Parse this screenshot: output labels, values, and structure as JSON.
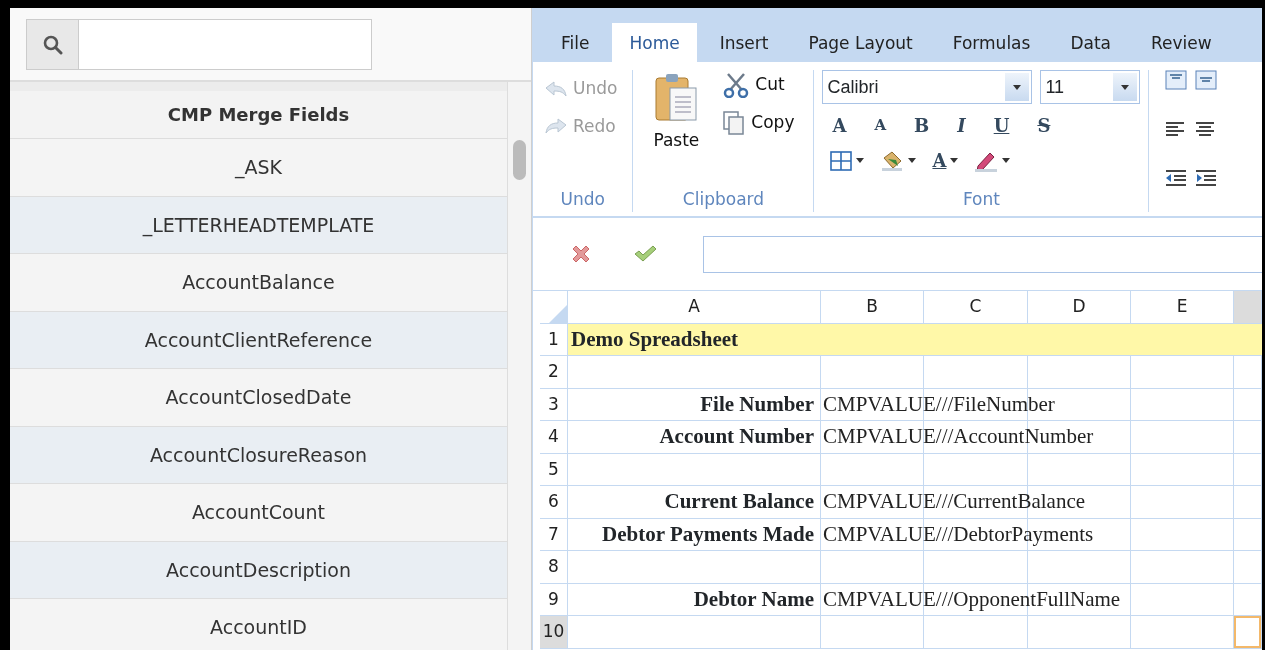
{
  "sidebar": {
    "header": "CMP Merge Fields",
    "items": [
      "_ASK",
      "_LETTERHEADTEMPLATE",
      "AccountBalance",
      "AccountClientReference",
      "AccountClosedDate",
      "AccountClosureReason",
      "AccountCount",
      "AccountDescription",
      "AccountID"
    ]
  },
  "ribbon": {
    "tabs": [
      {
        "label": "File",
        "selected": false
      },
      {
        "label": "Home",
        "selected": true
      },
      {
        "label": "Insert",
        "selected": false
      },
      {
        "label": "Page Layout",
        "selected": false
      },
      {
        "label": "Formulas",
        "selected": false
      },
      {
        "label": "Data",
        "selected": false
      },
      {
        "label": "Review",
        "selected": false
      }
    ],
    "groups": [
      {
        "kind": "undo",
        "label": "Undo",
        "buttons": [
          {
            "kind": "undo",
            "label": "Undo",
            "disabled": true
          },
          {
            "kind": "redo",
            "label": "Redo",
            "disabled": true
          }
        ]
      },
      {
        "kind": "clipboard",
        "label": "Clipboard",
        "buttons": [
          {
            "kind": "paste",
            "label": "Paste",
            "disabled": false
          },
          {
            "kind": "cut",
            "label": "Cut",
            "disabled": false
          },
          {
            "kind": "copy",
            "label": "Copy",
            "disabled": false
          }
        ]
      },
      {
        "kind": "font",
        "label": "Font",
        "font_name": "Calibri",
        "font_size": "11",
        "format_buttons": [
          {
            "kind": "grow",
            "glyph": "A"
          },
          {
            "kind": "shrink",
            "glyph": "A"
          },
          {
            "kind": "bold",
            "glyph": "B"
          },
          {
            "kind": "italic",
            "glyph": "I"
          },
          {
            "kind": "underline",
            "glyph": "U"
          },
          {
            "kind": "strike",
            "glyph": "S"
          }
        ],
        "tools": [
          {
            "kind": "borders"
          },
          {
            "kind": "fill"
          },
          {
            "kind": "font-color",
            "glyph": "A"
          },
          {
            "kind": "highlight"
          }
        ]
      },
      {
        "kind": "alignment",
        "icons": [
          {
            "kind": "align-top"
          },
          {
            "kind": "align-middle"
          },
          {
            "kind": "align-left"
          },
          {
            "kind": "align-center"
          },
          {
            "kind": "outdent"
          },
          {
            "kind": "indent"
          }
        ]
      }
    ]
  },
  "sheet": {
    "columns": [
      {
        "label": "A",
        "selected": false
      },
      {
        "label": "B",
        "selected": false
      },
      {
        "label": "C",
        "selected": false
      },
      {
        "label": "D",
        "selected": false
      },
      {
        "label": "E",
        "selected": false
      },
      {
        "selected": true
      }
    ],
    "rows": [
      {
        "number": "1",
        "selected": false,
        "kind": "title",
        "title": "Demo Spreadsheet"
      },
      {
        "number": "2",
        "selected": false,
        "kind": "entry"
      },
      {
        "number": "3",
        "selected": false,
        "kind": "entry",
        "label": "File Number",
        "value": "CMPVALUE///FileNumber"
      },
      {
        "number": "4",
        "selected": false,
        "kind": "entry",
        "label": "Account Number",
        "value": "CMPVALUE///AccountNumber"
      },
      {
        "number": "5",
        "selected": false,
        "kind": "entry"
      },
      {
        "number": "6",
        "selected": false,
        "kind": "entry",
        "label": "Current Balance",
        "value": "CMPVALUE///CurrentBalance"
      },
      {
        "number": "7",
        "selected": false,
        "kind": "entry",
        "label": "Debtor Payments Made",
        "value": "CMPVALUE///DebtorPayments"
      },
      {
        "number": "8",
        "selected": false,
        "kind": "entry"
      },
      {
        "number": "9",
        "selected": false,
        "kind": "entry",
        "label": "Debtor Name",
        "value": "CMPVALUE///OpponentFullName"
      },
      {
        "number": "10",
        "selected": true,
        "kind": "entry"
      }
    ]
  }
}
